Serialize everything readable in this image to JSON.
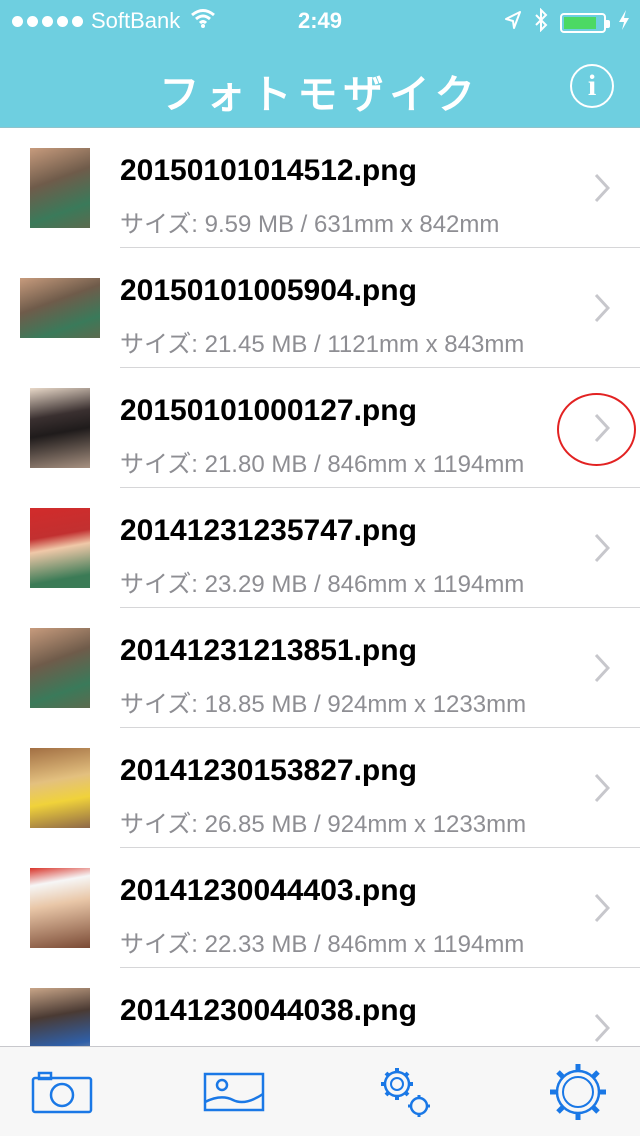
{
  "status_bar": {
    "carrier": "SoftBank",
    "time": "2:49",
    "battery_level": 0.85,
    "signal_bars": 5
  },
  "nav": {
    "title": "フォトモザイク",
    "info_label": "i"
  },
  "files": [
    {
      "name": "20150101014512.png",
      "detail": "サイズ: 9.59 MB / 631mm x 842mm"
    },
    {
      "name": "20150101005904.png",
      "detail": "サイズ: 21.45 MB / 1121mm x 843mm"
    },
    {
      "name": "20150101000127.png",
      "detail": "サイズ: 21.80 MB / 846mm x 1194mm"
    },
    {
      "name": "20141231235747.png",
      "detail": "サイズ: 23.29 MB / 846mm x 1194mm"
    },
    {
      "name": "20141231213851.png",
      "detail": "サイズ: 18.85 MB / 924mm x 1233mm"
    },
    {
      "name": "20141230153827.png",
      "detail": "サイズ: 26.85 MB / 924mm x 1233mm"
    },
    {
      "name": "20141230044403.png",
      "detail": "サイズ: 22.33 MB / 846mm x 1194mm"
    },
    {
      "name": "20141230044038.png",
      "detail": ""
    }
  ],
  "tabbar": {
    "items": [
      {
        "icon": "camera-icon"
      },
      {
        "icon": "photo-icon"
      },
      {
        "icon": "gears-icon"
      },
      {
        "icon": "gear-icon"
      }
    ]
  },
  "colors": {
    "header": "#6ecfe0",
    "tint": "#1a78e6",
    "highlight": "#e22222"
  }
}
